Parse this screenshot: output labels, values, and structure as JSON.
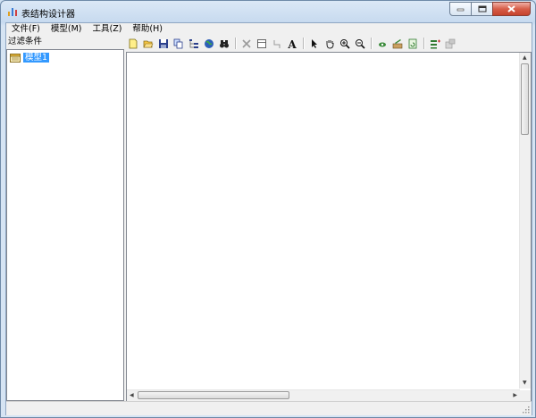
{
  "window": {
    "title": "表结构设计器",
    "controls": [
      "minimize",
      "maximize",
      "close"
    ]
  },
  "menubar": {
    "items": [
      {
        "label": "文件(F)"
      },
      {
        "label": "模型(M)"
      },
      {
        "label": "工具(Z)"
      },
      {
        "label": "帮助(H)"
      }
    ]
  },
  "left_panel": {
    "filter_label": "过滤条件",
    "tree": {
      "items": [
        {
          "label": "模型1",
          "icon": "model-icon",
          "selected": true
        }
      ]
    }
  },
  "toolbar": {
    "buttons": [
      "new-icon",
      "open-icon",
      "save-icon",
      "copy-icon",
      "tree-icon",
      "globe-icon",
      "binoculars-icon",
      "delete-icon",
      "table-icon",
      "relation-icon",
      "text-icon",
      "pointer-icon",
      "hand-icon",
      "zoom-in-icon",
      "zoom-out-icon",
      "view-icon",
      "edit-icon",
      "refresh-icon",
      "add-table-icon",
      "properties-icon"
    ]
  },
  "colors": {
    "selection": "#3399ff",
    "background": "#f0f0f0",
    "close_button": "#c5432d"
  }
}
